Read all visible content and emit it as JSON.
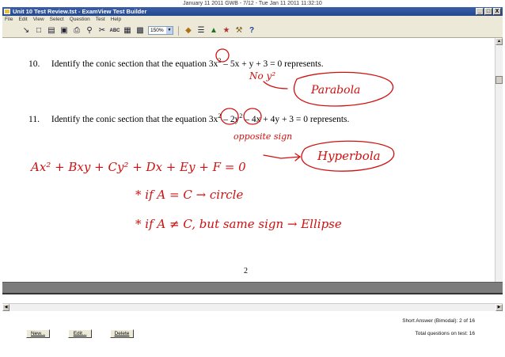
{
  "top_stamp": "January 11 2011 GWB - 7/12 - Tue Jan 11 2011 11:32:10",
  "window": {
    "title": "Unit 10 Test Review.tst - ExamView Test Builder",
    "controls": [
      "_",
      "□",
      "X"
    ]
  },
  "menu": [
    "File",
    "Edit",
    "View",
    "Select",
    "Question",
    "Test",
    "Help"
  ],
  "toolbar": {
    "zoom_value": "150%",
    "icons": [
      "select-icon",
      "new-icon",
      "open-icon",
      "save-icon",
      "print-icon",
      "find-icon",
      "cut-icon",
      "spell-check-icon",
      "calculator-icon",
      "table-icon",
      "format-icon",
      "list-icon",
      "sort-icon",
      "scramble-icon",
      "tools-icon",
      "help-icon"
    ]
  },
  "questions": [
    {
      "number": "10.",
      "text_before": "Identify the conic section that the equation 3x",
      "sup": "2",
      "text_after": " – 5x + y + 3 = 0 represents."
    },
    {
      "number": "11.",
      "text_before": "Identify the conic section that the equation 3x",
      "sup1": "2",
      "text_mid": " – 2y",
      "sup2": "2",
      "text_after": " – 4x + 4y + 3 = 0 represents."
    }
  ],
  "annotations": {
    "no_y2": "No y²",
    "parabola": "Parabola",
    "opposite_sign": "opposite sign",
    "hyperbola": "Hyperbola",
    "general_form": "Ax² + Bxy + Cy² + Dx + Ey + F = 0",
    "circle_rule": "* if A = C → circle",
    "ellipse_rule": "* if A ≠ C, but same sign → Ellipse",
    "ink_color": "#d01010"
  },
  "page_number": "2",
  "status": {
    "question_type": "Short Answer (Bimodal): 2 of 16",
    "total": "Total questions on test: 16"
  },
  "buttons": {
    "new": "New...",
    "edit": "Edit...",
    "delete": "Delete"
  }
}
